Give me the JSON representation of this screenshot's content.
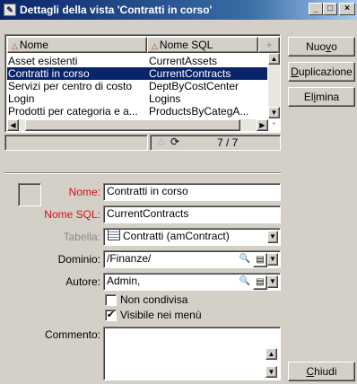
{
  "window": {
    "title": "Dettagli della vista 'Contratti in corso'",
    "controls": {
      "minimize": "_",
      "maximize": "□",
      "close": "×"
    }
  },
  "grid": {
    "columns": [
      "Nome",
      "Nome SQL"
    ],
    "rows": [
      {
        "name": "Asset esistenti",
        "sql": "CurrentAssets"
      },
      {
        "name": "Contratti in corso",
        "sql": "CurrentContracts"
      },
      {
        "name": "Servizi per centro di costo",
        "sql": "DeptByCostCenter"
      },
      {
        "name": "Login",
        "sql": "Logins"
      },
      {
        "name": "Prodotti per categoria e a...",
        "sql": "ProductsByCategA..."
      }
    ],
    "selected_index": 1,
    "counter": "7 / 7",
    "plus": "+"
  },
  "buttons": {
    "new": {
      "pre": "Nuo",
      "u": "v",
      "post": "o"
    },
    "duplicate": {
      "pre": "",
      "u": "D",
      "post": "uplicazione"
    },
    "delete": {
      "pre": "El",
      "u": "i",
      "post": "mina"
    },
    "close": {
      "pre": "",
      "u": "C",
      "post": "hiudi"
    }
  },
  "form": {
    "name_label": "Nome:",
    "name_value": "Contratti in corso",
    "sql_label": "Nome SQL:",
    "sql_value": "CurrentContracts",
    "table_label": "Tabella:",
    "table_value": "Contratti (amContract)",
    "domain_label": "Dominio:",
    "domain_value": "/Finanze/",
    "author_label": "Autore:",
    "author_value": "Admin,",
    "not_shared_label": "Non condivisa",
    "not_shared_checked": false,
    "visible_label": "Visibile nei menù",
    "visible_checked": true,
    "comment_label": "Commento:",
    "comment_value": ""
  },
  "colors": {
    "selection": "#0a246a",
    "required_label": "#d01010",
    "face": "#d4d0c8"
  }
}
